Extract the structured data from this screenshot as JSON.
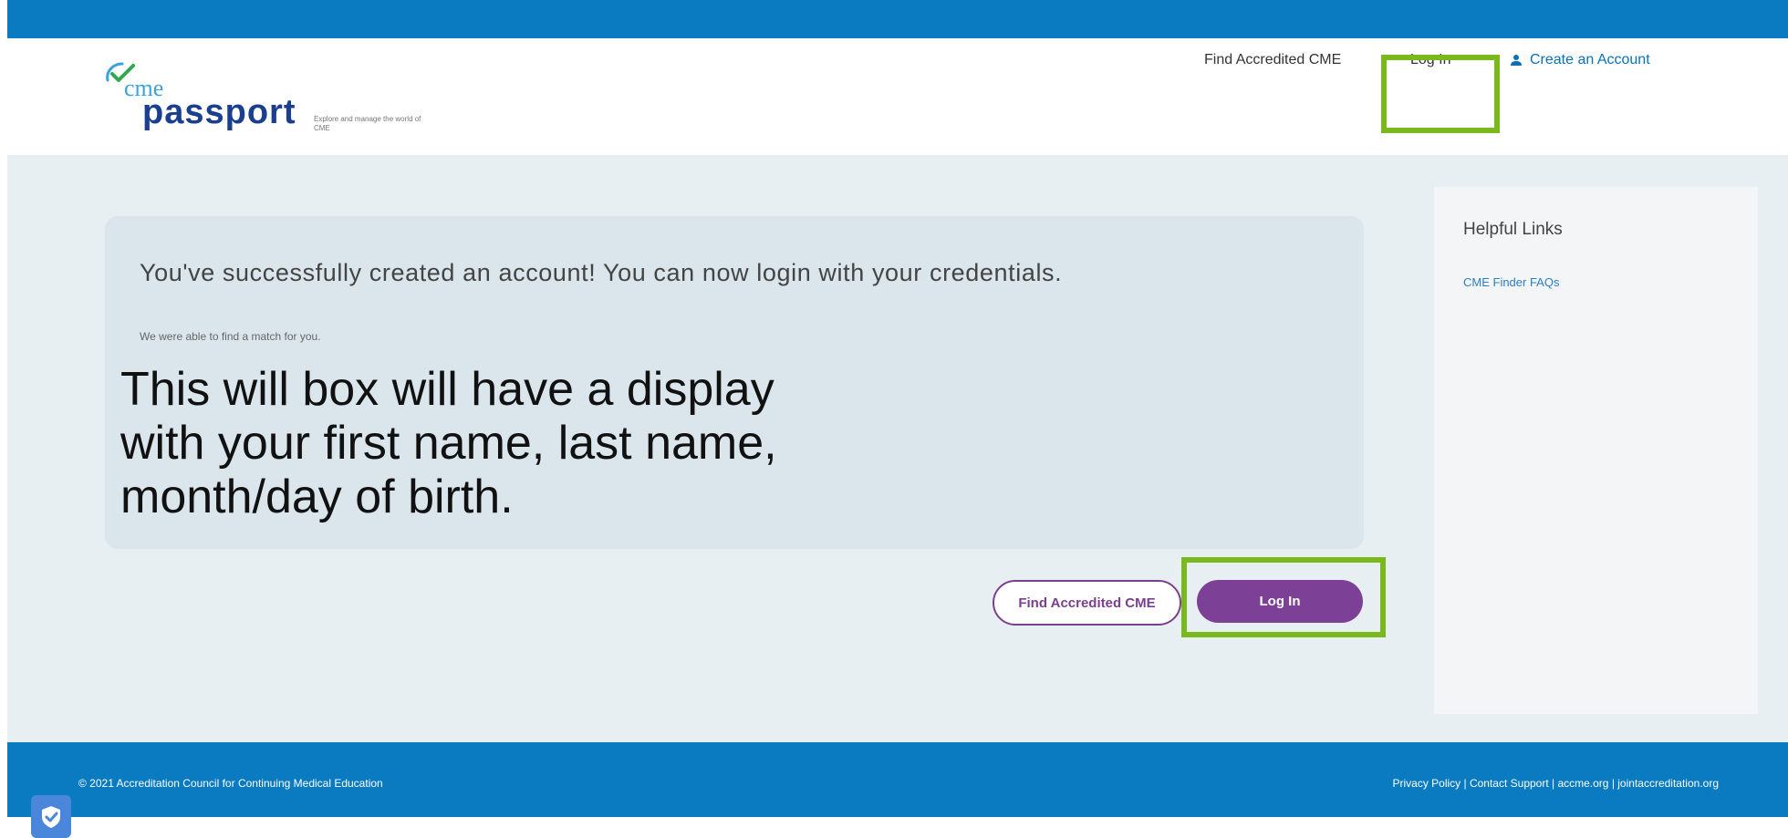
{
  "header": {
    "logo": {
      "cme": "cme",
      "passport": "passport",
      "tagline": "Explore and manage the world of CME"
    },
    "nav": {
      "find": "Find Accredited CME",
      "login": "Log In",
      "create": "Create an Account"
    }
  },
  "card": {
    "title": "You've successfully created an account! You can now login with your credentials.",
    "subtitle": "We were able to find a match for you.",
    "message": "This will box will have a display\nwith your first name, last name,\nmonth/day of birth."
  },
  "buttons": {
    "find": "Find Accredited CME",
    "login": "Log In"
  },
  "sidebar": {
    "title": "Helpful Links",
    "links": [
      "CME Finder FAQs"
    ]
  },
  "footer": {
    "copyright": "© 2021 Accreditation Council for Continuing Medical Education",
    "links": "Privacy Policy  |  Contact Support  |  accme.org  |  jointaccreditation.org"
  },
  "colors": {
    "brand_blue": "#0a7bc0",
    "purple": "#7c4196",
    "highlight_green": "#7ab91c",
    "background": "#e8eff3"
  },
  "icons": {
    "logo": "checkmark-swoosh-icon",
    "create_account": "person-icon",
    "privacy": "shield-check-icon"
  }
}
